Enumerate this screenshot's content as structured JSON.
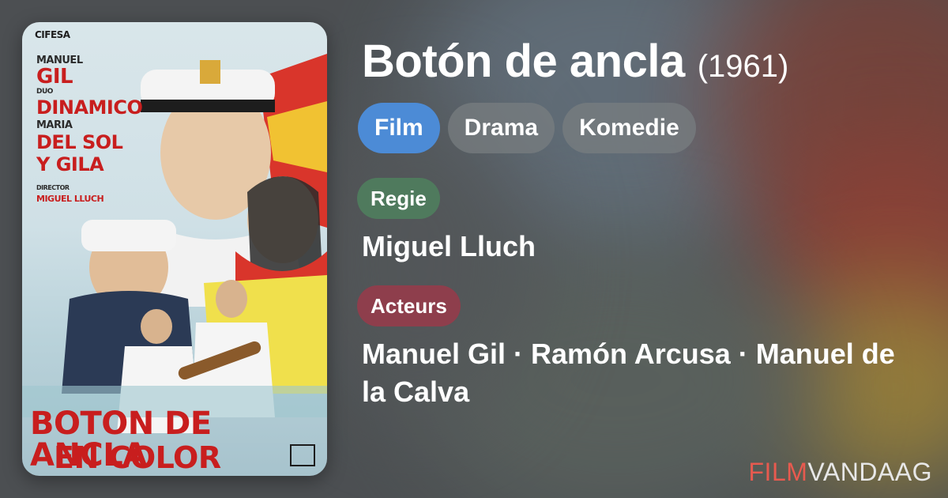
{
  "movie": {
    "title": "Botón de ancla",
    "year": "(1961)",
    "tags": [
      "Film",
      "Drama",
      "Komedie"
    ]
  },
  "sections": {
    "director": {
      "label": "Regie",
      "value": "Miguel Lluch"
    },
    "cast": {
      "label": "Acteurs",
      "value": "Manuel Gil · Ramón Arcusa · Manuel de la Calva"
    }
  },
  "poster": {
    "studio_mark": "CIFESA",
    "credits": [
      "MANUEL",
      "GIL",
      "DUO",
      "DINAMICO",
      "MARIA",
      "DEL SOL",
      "Y GILA"
    ],
    "director_label": "DIRECTOR",
    "director_name": "MIGUEL LLUCH",
    "title_line1": "BOTON DE ANCLA",
    "title_line2": "EN COLOR"
  },
  "brand": {
    "part1": "FILM",
    "part2": "VANDAAG"
  },
  "colors": {
    "tag_primary": "#4c8bd6",
    "label_director": "#4f7a5d",
    "label_cast": "#8e3e4c",
    "brand_accent": "#e85a4f"
  }
}
